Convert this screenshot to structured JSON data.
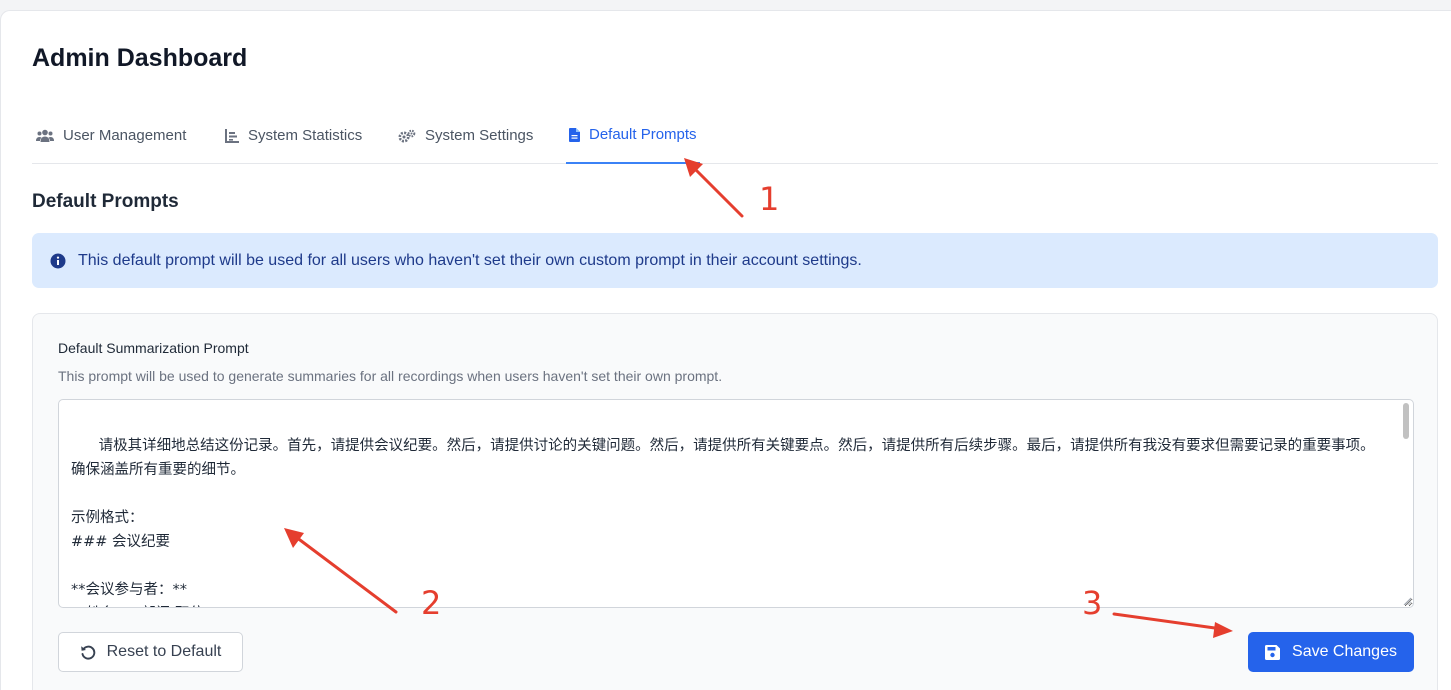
{
  "page": {
    "title": "Admin Dashboard"
  },
  "tabs": [
    {
      "label": "User Management",
      "icon": "users-icon"
    },
    {
      "label": "System Statistics",
      "icon": "chart-icon"
    },
    {
      "label": "System Settings",
      "icon": "gears-icon"
    },
    {
      "label": "Default Prompts",
      "icon": "file-icon",
      "active": true
    }
  ],
  "section": {
    "title": "Default Prompts"
  },
  "alert": {
    "text": "This default prompt will be used for all users who haven't set their own custom prompt in their account settings.",
    "icon": "info-circle-icon"
  },
  "prompt_field": {
    "label": "Default Summarization Prompt",
    "help": "This prompt will be used to generate summaries for all recordings when users haven't set their own prompt.",
    "value": "请极其详细地总结这份记录。首先，请提供会议纪要。然后，请提供讨论的关键问题。然后，请提供所有关键要点。然后，请提供所有后续步骤。最后，请提供所有我没有要求但需要记录的重要事项。确保涵盖所有重要的细节。\n\n示例格式：\n### 会议纪要\n\n**会议参与者：**\n- [姓名] - [部门/职位]\n- [姓名] - [部门/职位]"
  },
  "buttons": {
    "reset_label": "Reset to Default",
    "reset_icon": "undo-icon",
    "save_label": "Save Changes",
    "save_icon": "floppy-disk-icon"
  },
  "annotations": {
    "label_1": "1",
    "label_2": "2",
    "label_3": "3",
    "color": "#e53e2e"
  },
  "colors": {
    "accent": "#2563eb",
    "alert_bg": "#dbeafe",
    "alert_text": "#1e3a8a"
  }
}
